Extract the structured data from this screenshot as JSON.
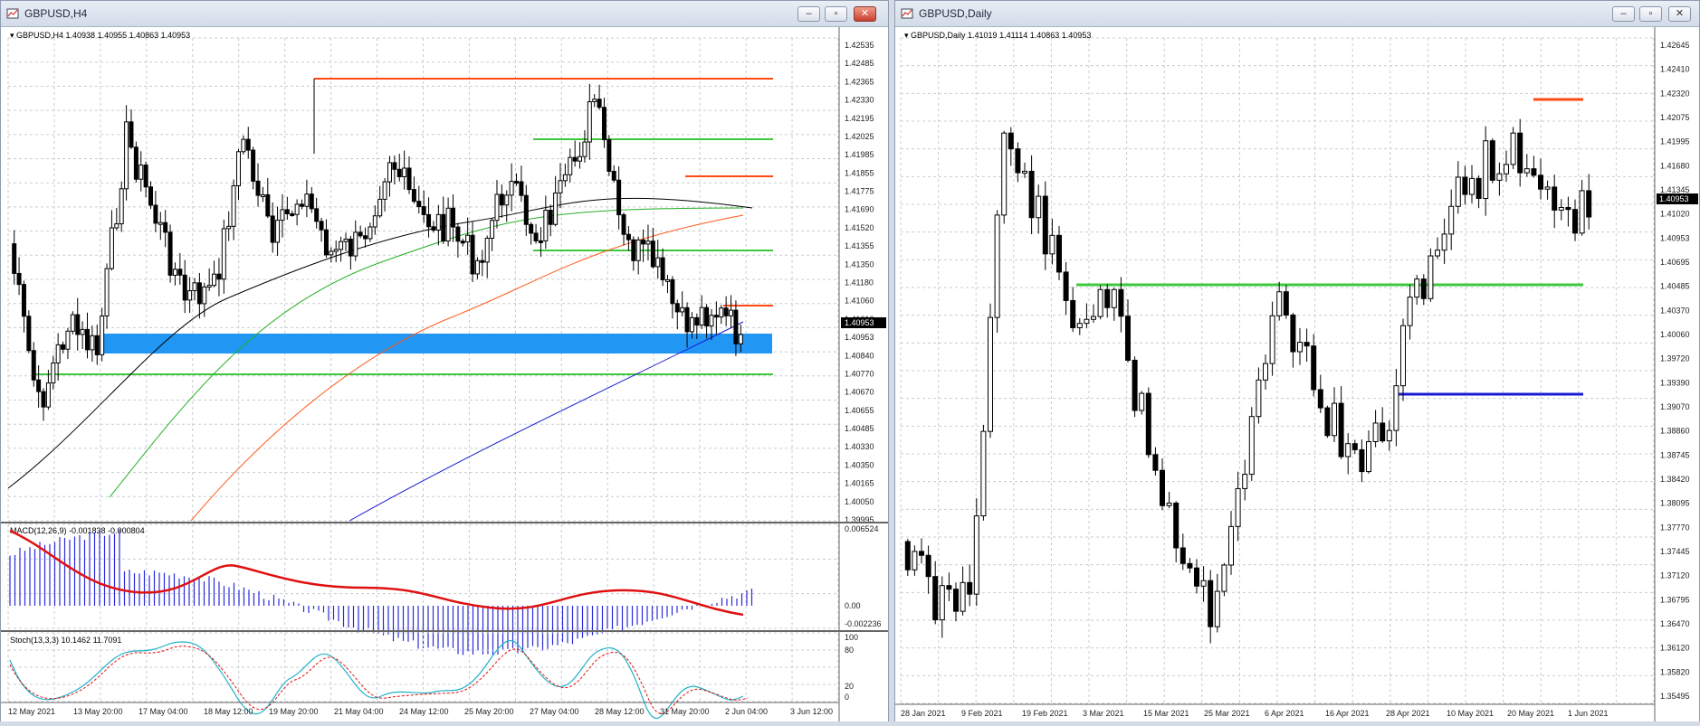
{
  "windows": {
    "left": {
      "title": "GBPUSD,H4",
      "buttons": [
        "–",
        "▫",
        "✕"
      ],
      "header": {
        "symbol": "GBPUSD,H4",
        "ohlc": "1.40938 1.40955 1.40863 1.40953"
      },
      "price_axis": [
        "1.42535",
        "1.42485",
        "1.42365",
        "1.42330",
        "1.42195",
        "1.42025",
        "1.41985",
        "1.41855",
        "1.41775",
        "1.41690",
        "1.41520",
        "1.41355",
        "1.41350",
        "1.41180",
        "1.41060",
        "1.41010",
        "1.40953",
        "1.40840",
        "1.40770",
        "1.40670",
        "1.40655",
        "1.40485",
        "1.40330",
        "1.40350",
        "1.40165",
        "1.40050",
        "1.39995"
      ],
      "current_price": "1.40953",
      "macd": {
        "label": "MACD(12,26,9) -0.001838 -0.000804",
        "axis": [
          "0.006524",
          "0.00",
          "-0.002236"
        ]
      },
      "stoch": {
        "label": "Stoch(13,3,3) 10.1462 11.7091",
        "axis": [
          "100",
          "80",
          "20",
          "0"
        ]
      },
      "time_axis": [
        "12 May 2021",
        "13 May 20:00",
        "17 May 04:00",
        "18 May 12:00",
        "19 May 20:00",
        "21 May 04:00",
        "24 May 12:00",
        "25 May 20:00",
        "27 May 04:00",
        "28 May 12:00",
        "31 May 20:00",
        "2 Jun 04:00",
        "3 Jun 12:00"
      ]
    },
    "right": {
      "title": "GBPUSD,Daily",
      "buttons": [
        "–",
        "▫",
        "✕"
      ],
      "header": {
        "symbol": "GBPUSD,Daily",
        "ohlc": "1.41019 1.41114 1.40863 1.40953"
      },
      "price_axis": [
        "1.42645",
        "1.42410",
        "1.42320",
        "1.42075",
        "1.41995",
        "1.41680",
        "1.41345",
        "1.41020",
        "1.40953",
        "1.40695",
        "1.40485",
        "1.40370",
        "1.40060",
        "1.39720",
        "1.39390",
        "1.39070",
        "1.38860",
        "1.38745",
        "1.38420",
        "1.38095",
        "1.37770",
        "1.37445",
        "1.37120",
        "1.36795",
        "1.36470",
        "1.36120",
        "1.35820",
        "1.35495"
      ],
      "current_price": "1.40953",
      "time_axis": [
        "28 Jan 2021",
        "9 Feb 2021",
        "19 Feb 2021",
        "3 Mar 2021",
        "15 Mar 2021",
        "25 Mar 2021",
        "6 Apr 2021",
        "16 Apr 2021",
        "28 Apr 2021",
        "10 May 2021",
        "20 May 2021",
        "1 Jun 2021"
      ]
    }
  },
  "colors": {
    "grid": "#c8ccd4",
    "bull": "#ffffff",
    "bear": "#000000",
    "green_level": "#3ec83e",
    "red_level": "#ff4a12",
    "blue_zone": "#2196f3",
    "blue_line": "#1a1ad6",
    "macd_hist": "#2a2ad8",
    "macd_signal": "#e01010",
    "stoch_main": "#20b2c8",
    "stoch_signal": "#e01010"
  }
}
